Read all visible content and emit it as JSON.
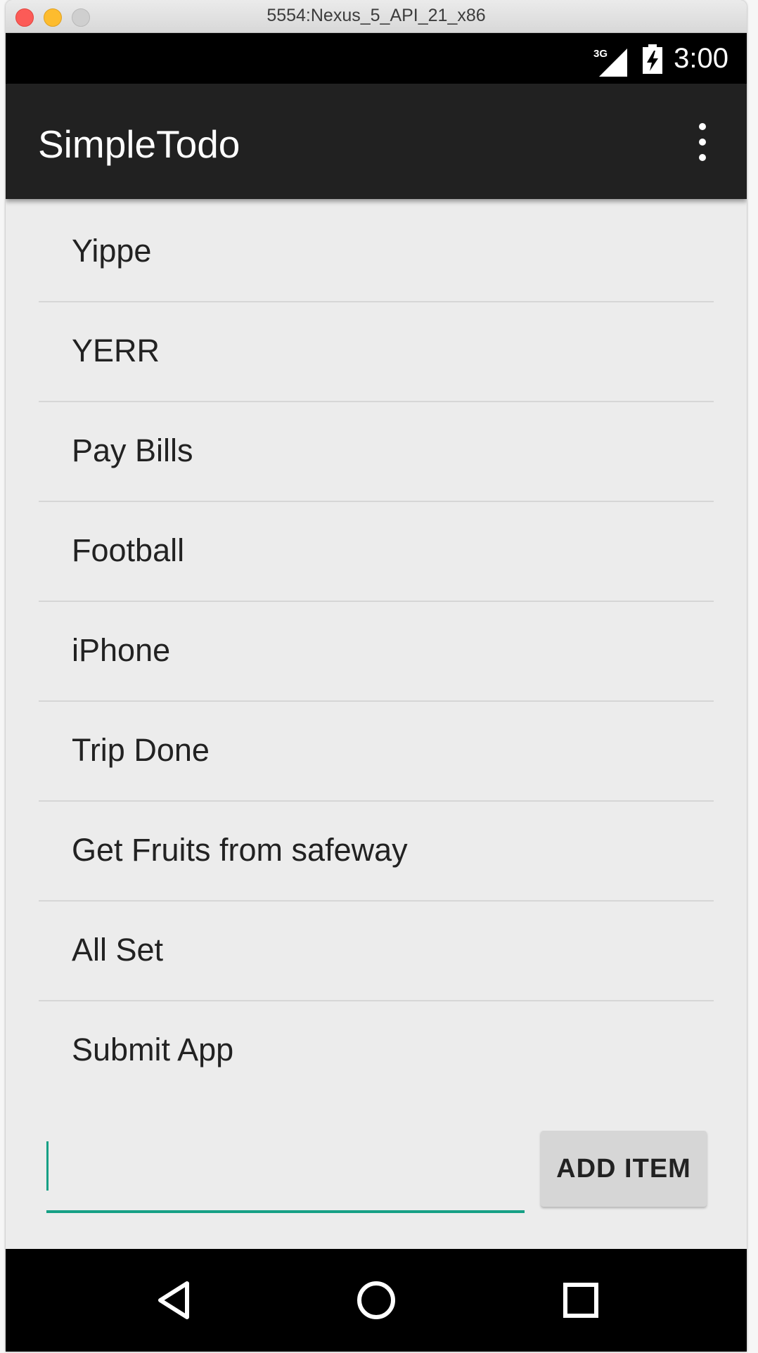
{
  "window": {
    "title": "5554:Nexus_5_API_21_x86"
  },
  "status_bar": {
    "network": "3G",
    "time": "3:00"
  },
  "app_bar": {
    "title": "SimpleTodo",
    "menu_icon": "overflow-menu-icon"
  },
  "todo_list": {
    "items": [
      {
        "label": "Yippe"
      },
      {
        "label": "YERR"
      },
      {
        "label": "Pay Bills"
      },
      {
        "label": "Football"
      },
      {
        "label": "iPhone"
      },
      {
        "label": "Trip Done"
      },
      {
        "label": "Get Fruits from safeway"
      },
      {
        "label": "All Set"
      },
      {
        "label": "Submit App"
      }
    ]
  },
  "new_item": {
    "value": "",
    "button_label": "ADD ITEM"
  },
  "nav_bar": {
    "buttons": [
      "back-icon",
      "home-icon",
      "recents-icon"
    ]
  },
  "colors": {
    "accent": "#16a085",
    "app_bar": "#212121",
    "background": "#ececec"
  }
}
